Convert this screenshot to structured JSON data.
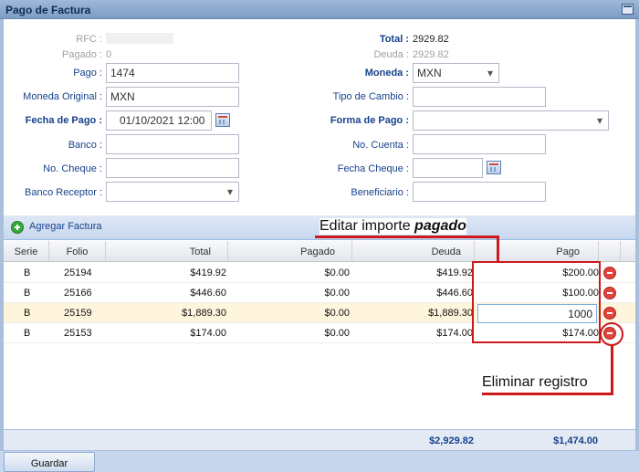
{
  "window": {
    "title": "Pago de Factura"
  },
  "form": {
    "rfc_label": "RFC :",
    "pagado_label": "Pagado :",
    "pagado_value": "0",
    "pago_label": "Pago :",
    "pago_value": "1474",
    "moneda_original_label": "Moneda Original :",
    "moneda_original_value": "MXN",
    "fecha_pago_label": "Fecha de Pago :",
    "fecha_pago_value": "01/10/2021 12:00",
    "banco_label": "Banco :",
    "no_cheque_label": "No. Cheque :",
    "banco_receptor_label": "Banco Receptor :",
    "total_label": "Total :",
    "total_value": "2929.82",
    "deuda_label": "Deuda :",
    "deuda_value": "2929.82",
    "moneda_label": "Moneda :",
    "moneda_value": "MXN",
    "tipo_cambio_label": "Tipo de Cambio :",
    "forma_pago_label": "Forma de Pago :",
    "no_cuenta_label": "No. Cuenta :",
    "fecha_cheque_label": "Fecha Cheque :",
    "beneficiario_label": "Beneficiario :"
  },
  "grid": {
    "add_label": "Agregar Factura",
    "columns": [
      "Serie",
      "Folio",
      "Total",
      "Pagado",
      "Deuda",
      "Pago"
    ],
    "rows": [
      {
        "serie": "B",
        "folio": "25194",
        "total": "$419.92",
        "pagado": "$0.00",
        "deuda": "$419.92",
        "pago": "$200.00"
      },
      {
        "serie": "B",
        "folio": "25166",
        "total": "$446.60",
        "pagado": "$0.00",
        "deuda": "$446.60",
        "pago": "$100.00"
      },
      {
        "serie": "B",
        "folio": "25159",
        "total": "$1,889.30",
        "pagado": "$0.00",
        "deuda": "$1,889.30",
        "pago": "1000"
      },
      {
        "serie": "B",
        "folio": "25153",
        "total": "$174.00",
        "pagado": "$0.00",
        "deuda": "$174.00",
        "pago": "$174.00"
      }
    ],
    "sum_deuda": "$2,929.82",
    "sum_pago": "$1,474.00"
  },
  "footer": {
    "save_label": "Guardar"
  },
  "annotations": {
    "edit_prefix": "Editar importe ",
    "edit_emph": "pagado",
    "delete_label": "Eliminar registro"
  }
}
